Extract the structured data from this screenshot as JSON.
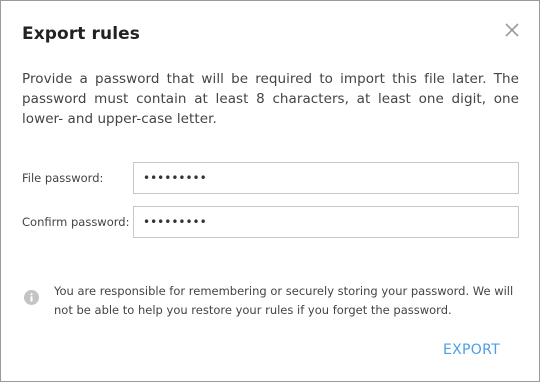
{
  "dialog": {
    "title": "Export rules",
    "description": "Provide a password that will be required to import this file later. The password must contain at least 8 characters, at least one digit, one lower- and upper-case letter.",
    "close_icon": "close-icon"
  },
  "fields": {
    "file_password_label": "File password:",
    "file_password_value": "•••••••••",
    "confirm_password_label": "Confirm password:",
    "confirm_password_value": "•••••••••"
  },
  "notice": {
    "icon": "info-icon",
    "text": "You are responsible for remembering or securely storing your password. We will not be able to help you restore your rules if you forget the password."
  },
  "actions": {
    "export_label": "EXPORT"
  },
  "colors": {
    "accent": "#4a9ee6",
    "border": "#c8c8c8",
    "info_icon": "#c4c4c4"
  }
}
